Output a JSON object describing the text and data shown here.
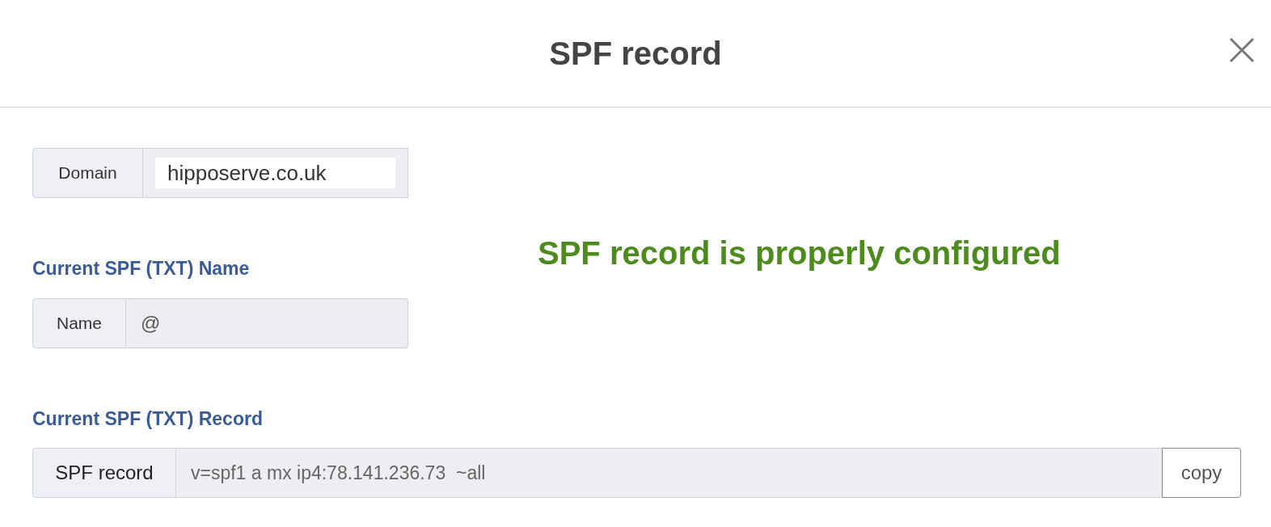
{
  "dialog": {
    "title": "SPF record"
  },
  "domain": {
    "label": "Domain",
    "value": "hipposerve.co.uk"
  },
  "status": {
    "message": "SPF record is properly configured"
  },
  "name_section": {
    "heading": "Current SPF (TXT) Name",
    "label": "Name",
    "value": "@"
  },
  "record_section": {
    "heading": "Current SPF (TXT) Record",
    "label": "SPF record",
    "value": "v=spf1 a mx ip4:78.141.236.73  ~all",
    "copy_button": "copy"
  }
}
